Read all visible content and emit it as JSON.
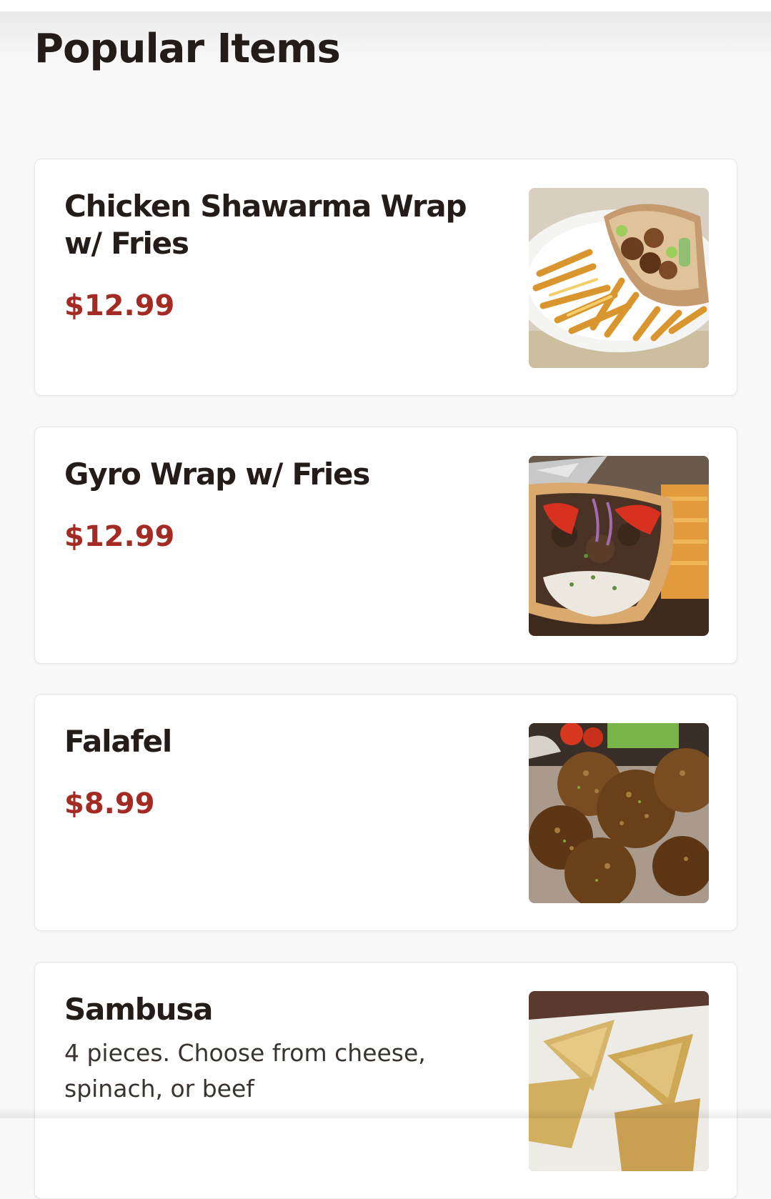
{
  "section": {
    "title": "Popular Items"
  },
  "items": [
    {
      "name": "Chicken Shawarma Wrap w/ Fries",
      "price": "$12.99",
      "description": "",
      "image_icon": "chicken-shawarma-photo"
    },
    {
      "name": "Gyro Wrap w/ Fries",
      "price": "$12.99",
      "description": "",
      "image_icon": "gyro-wrap-photo"
    },
    {
      "name": "Falafel",
      "price": "$8.99",
      "description": "",
      "image_icon": "falafel-photo"
    },
    {
      "name": "Sambusa",
      "price": "",
      "description": "4 pieces. Choose from cheese, spinach, or beef",
      "image_icon": "sambusa-photo"
    }
  ],
  "colors": {
    "background": "#f8f8f8",
    "card": "#ffffff",
    "title_text": "#231c19",
    "price": "#a32b24"
  }
}
